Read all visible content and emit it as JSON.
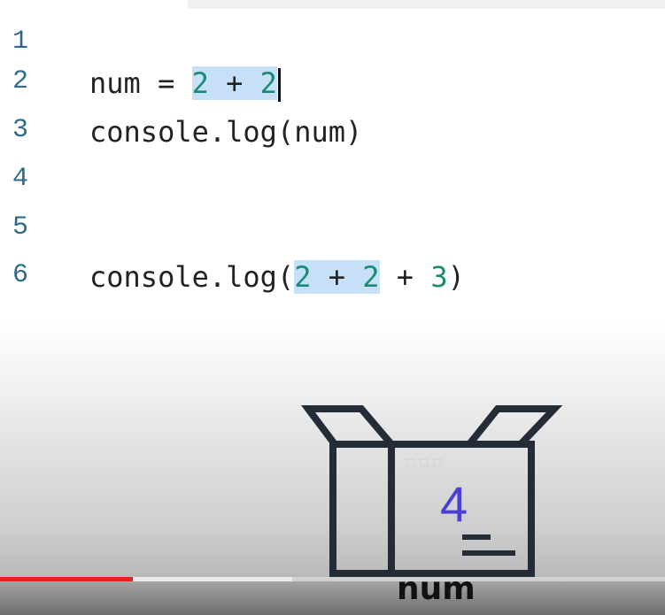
{
  "editor": {
    "lines": [
      {
        "number": "1",
        "code": ""
      },
      {
        "number": "2",
        "prefix": "num = ",
        "sel_a": "2",
        "sel_op": " + ",
        "sel_b": "2"
      },
      {
        "number": "3",
        "code": "console.log(num)"
      },
      {
        "number": "4",
        "code": ""
      },
      {
        "number": "5",
        "code": ""
      },
      {
        "number": "6",
        "prefix": "console.log(",
        "sel_a": "2",
        "sel_op": " + ",
        "sel_b": "2",
        "rest_op": " + ",
        "rest_num": "3",
        "close": ")"
      }
    ]
  },
  "illustration": {
    "box_value": "4",
    "box_label": "num",
    "digit_color": "#4a3fd0"
  },
  "video": {
    "progress_fraction": 0.2,
    "buffered_fraction": 0.44,
    "progress_color": "#e81f1f"
  }
}
